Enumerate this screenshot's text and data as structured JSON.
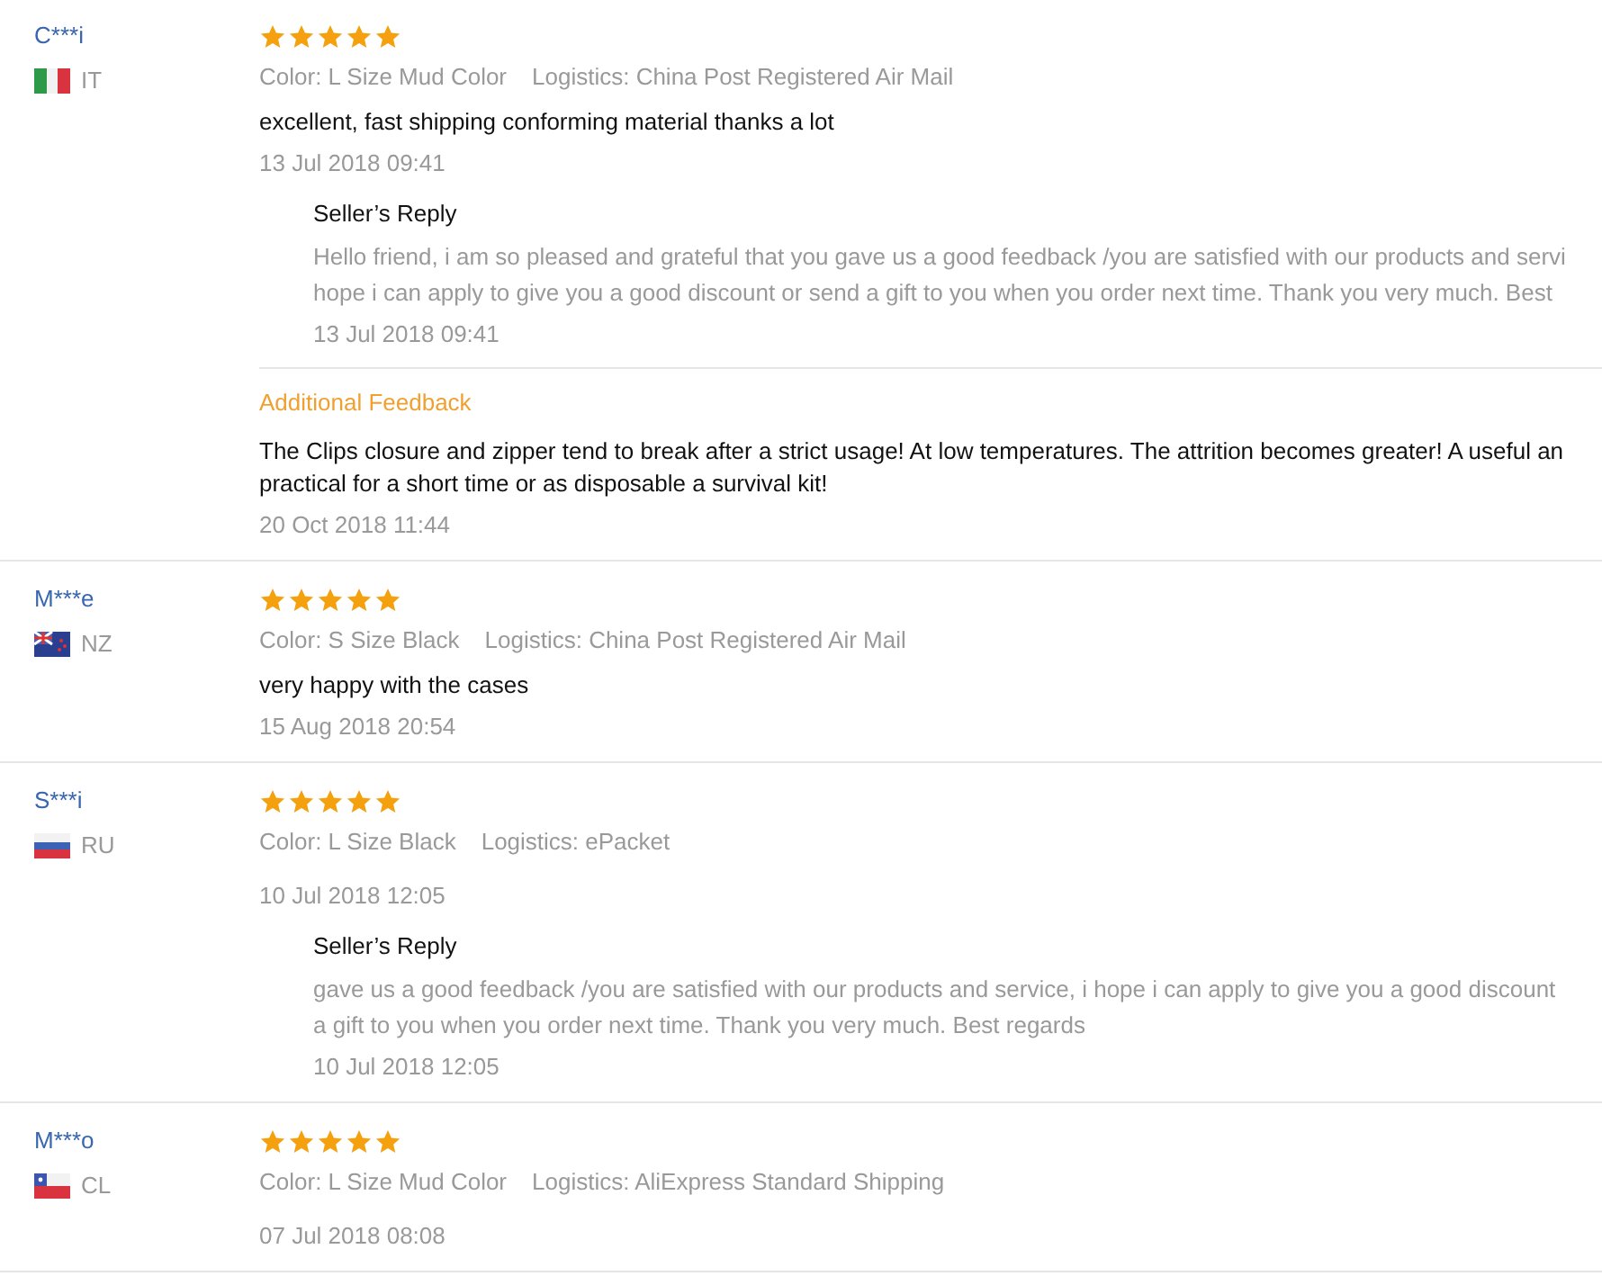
{
  "reviews": [
    {
      "user": "C***i",
      "flag": {
        "kind": "it"
      },
      "country": "IT",
      "stars": 5,
      "variant": "Color: L Size Mud Color",
      "logistics": "Logistics: China Post Registered Air Mail",
      "text": "excellent, fast shipping conforming material thanks a lot",
      "date": "13 Jul 2018 09:41",
      "reply": {
        "title": "Seller’s Reply",
        "lines": [
          "Hello friend, i am so pleased and grateful that you gave us a good feedback /you are satisfied with our products and servi",
          "hope i can apply to give you a good discount or send a gift to you when you order next time. Thank you very much. Best"
        ],
        "date": "13 Jul 2018 09:41"
      },
      "additional": {
        "title": "Additional Feedback",
        "lines": [
          "The Clips closure and zipper tend to break after a strict usage! At low temperatures. The attrition becomes greater! A useful an",
          "practical for a short time or as disposable a survival kit!"
        ],
        "date": "20 Oct 2018 11:44"
      }
    },
    {
      "user": "M***e",
      "flag": {
        "kind": "nz"
      },
      "country": "NZ",
      "stars": 5,
      "variant": "Color: S Size Black",
      "logistics": "Logistics: China Post Registered Air Mail",
      "text": "very happy with the cases",
      "date": "15 Aug 2018 20:54"
    },
    {
      "user": "S***i",
      "flag": {
        "kind": "ru"
      },
      "country": "RU",
      "stars": 5,
      "variant": "Color: L Size Black",
      "logistics": "Logistics: ePacket",
      "date": "10 Jul 2018 12:05",
      "reply": {
        "title": "Seller’s Reply",
        "lines": [
          "gave us a good feedback /you are satisfied with our products and service, i hope i can apply to give you a good discount",
          "a gift to you when you order next time. Thank you very much. Best regards"
        ],
        "date": "10 Jul 2018 12:05"
      }
    },
    {
      "user": "M***o",
      "flag": {
        "kind": "cl"
      },
      "country": "CL",
      "stars": 5,
      "variant": "Color: L Size Mud Color",
      "logistics": "Logistics: AliExpress Standard Shipping",
      "date": "07 Jul 2018 08:08"
    }
  ]
}
